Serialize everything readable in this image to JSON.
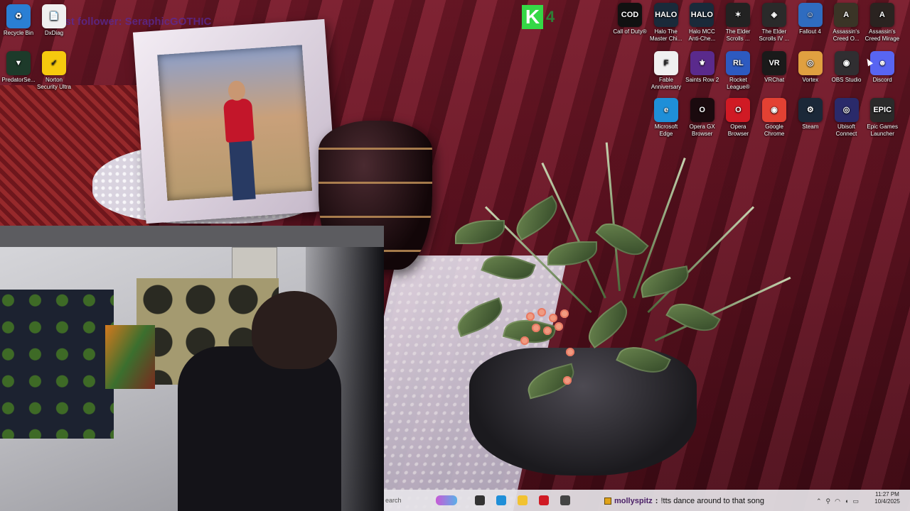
{
  "overlay": {
    "banner_text": "Last follower: SeraphicGOTHIC",
    "counter_letter": "K",
    "counter_value": "4"
  },
  "desktop_icons_left": [
    {
      "label": "Recycle Bin",
      "icon": "recycle-bin-icon",
      "color": "#2a7fd4",
      "glyph": "♻"
    },
    {
      "label": "DxDiag",
      "icon": "document-icon",
      "color": "#f0f0f0",
      "glyph": "📄"
    },
    {
      "label": "PredatorSe...",
      "icon": "predator-sense-icon",
      "color": "#1d3a2a",
      "glyph": "▼"
    },
    {
      "label": "Norton Security Ultra",
      "icon": "norton-icon",
      "color": "#f6c90e",
      "glyph": "✓"
    }
  ],
  "desktop_icons_right_row1": [
    {
      "label": "Call of Duty®",
      "icon": "call-of-duty-icon",
      "color": "#111111",
      "glyph": "COD"
    },
    {
      "label": "Halo The Master Chi...",
      "icon": "halo-mcc-icon",
      "color": "#1a2a3a",
      "glyph": "HALO"
    },
    {
      "label": "Halo MCC Anti-Che...",
      "icon": "halo-anticheat-icon",
      "color": "#1a2a3a",
      "glyph": "HALO"
    },
    {
      "label": "The Elder Scrolls ...",
      "icon": "elder-scrolls-icon",
      "color": "#222222",
      "glyph": "✶"
    },
    {
      "label": "The Elder Scrolls IV ...",
      "icon": "oblivion-icon",
      "color": "#2a2a2a",
      "glyph": "◈"
    },
    {
      "label": "Fallout 4",
      "icon": "fallout-icon",
      "color": "#2f6cc0",
      "glyph": "☺"
    },
    {
      "label": "Assassin's Creed O...",
      "icon": "assassins-creed-origins-icon",
      "color": "#3a3426",
      "glyph": "A"
    },
    {
      "label": "Assassin's Creed Mirage",
      "icon": "assassins-creed-mirage-icon",
      "color": "#2a2320",
      "glyph": "A"
    }
  ],
  "desktop_icons_right_row2": [
    {
      "label": "Fable Anniversary",
      "icon": "fable-icon",
      "color": "#f0f0f0",
      "glyph": "F"
    },
    {
      "label": "Saints Row 2",
      "icon": "saints-row-icon",
      "color": "#5a2a8c",
      "glyph": "⚜"
    },
    {
      "label": "Rocket League®",
      "icon": "rocket-league-icon",
      "color": "#2d5ac0",
      "glyph": "RL"
    },
    {
      "label": "VRChat",
      "icon": "vrchat-icon",
      "color": "#1a1a1a",
      "glyph": "VR"
    },
    {
      "label": "Vortex",
      "icon": "vortex-icon",
      "color": "#e0a040",
      "glyph": "◎"
    },
    {
      "label": "OBS Studio",
      "icon": "obs-icon",
      "color": "#302e31",
      "glyph": "◉"
    },
    {
      "label": "Discord",
      "icon": "discord-icon",
      "color": "#5865f2",
      "glyph": "☻"
    }
  ],
  "desktop_icons_right_row3": [
    {
      "label": "Microsoft Edge",
      "icon": "edge-icon",
      "color": "#1f8fd8",
      "glyph": "e"
    },
    {
      "label": "Opera GX Browser",
      "icon": "opera-gx-icon",
      "color": "#1a0a0e",
      "glyph": "O"
    },
    {
      "label": "Opera Browser",
      "icon": "opera-icon",
      "color": "#d01a24",
      "glyph": "O"
    },
    {
      "label": "Google Chrome",
      "icon": "chrome-icon",
      "color": "#e34133",
      "glyph": "◉"
    },
    {
      "label": "Steam",
      "icon": "steam-icon",
      "color": "#1b2838",
      "glyph": "⚙"
    },
    {
      "label": "Ubisoft Connect",
      "icon": "ubisoft-icon",
      "color": "#2a2a6a",
      "glyph": "◎"
    },
    {
      "label": "Epic Games Launcher",
      "icon": "epic-games-icon",
      "color": "#2a2a2a",
      "glyph": "EPIC"
    }
  ],
  "taskbar": {
    "search_placeholder": "earch",
    "buttons": [
      {
        "name": "task-view-button",
        "icon": "task-view-icon",
        "color": "#333333"
      },
      {
        "name": "edge-taskbar-button",
        "icon": "edge-icon",
        "color": "#1f8fd8"
      },
      {
        "name": "file-explorer-button",
        "icon": "folder-icon",
        "color": "#f2c230"
      },
      {
        "name": "opera-taskbar-button",
        "icon": "opera-icon",
        "color": "#d01a24"
      },
      {
        "name": "app-taskbar-button",
        "icon": "app-icon",
        "color": "#444444"
      }
    ]
  },
  "chat": {
    "username": "mollyspitz",
    "separator": ":",
    "message": "!tts dance around to that song"
  },
  "clock": {
    "time": "11:27 PM",
    "date": "10/4/2025"
  }
}
